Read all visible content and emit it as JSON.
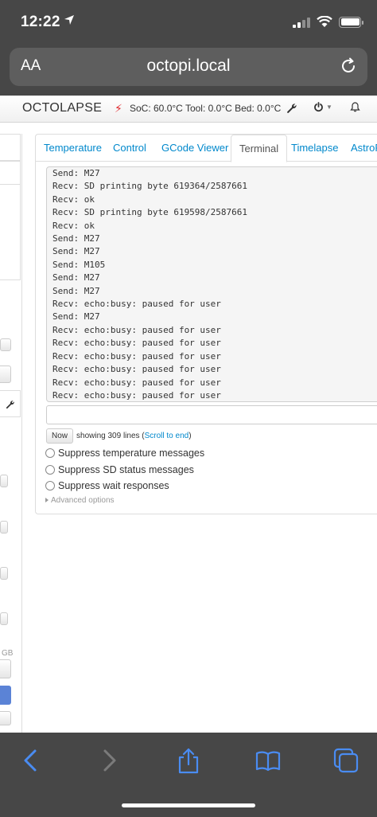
{
  "status_bar": {
    "time": "12:22"
  },
  "browser": {
    "text_size_label": "AA",
    "url": "octopi.local"
  },
  "navbar": {
    "brand": "OCTOLAPSE",
    "temperatures": "SoC: 60.0°C Tool: 0.0°C Bed: 0.0°C",
    "icons": [
      "bolt-icon",
      "wrench-icon",
      "power-icon",
      "bell-icon"
    ]
  },
  "tabs": [
    {
      "label": "Temperature"
    },
    {
      "label": "Control"
    },
    {
      "label": "GCode Viewer"
    },
    {
      "label": "Terminal",
      "active": true
    },
    {
      "label": "Timelapse"
    },
    {
      "label": "AstroF"
    }
  ],
  "terminal": {
    "lines": [
      "Send: M27",
      "Recv: SD printing byte 619364/2587661",
      "Recv: ok",
      "Recv: SD printing byte 619598/2587661",
      "Recv: ok",
      "Send: M27",
      "Send: M27",
      "Send: M105",
      "Send: M27",
      "Send: M27",
      "Recv: echo:busy: paused for user",
      "Send: M27",
      "Recv: echo:busy: paused for user",
      "Recv: echo:busy: paused for user",
      "Recv: echo:busy: paused for user",
      "Recv: echo:busy: paused for user",
      "Recv: echo:busy: paused for user",
      "Recv: echo:busy: paused for user"
    ],
    "command_value": "",
    "now_button": "Now",
    "line_info": "showing 309 lines (",
    "scroll_link": "Scroll to end",
    "line_info_close": ")",
    "options": [
      {
        "label": "Suppress temperature messages",
        "checked": false
      },
      {
        "label": "Suppress SD status messages",
        "checked": false
      },
      {
        "label": "Suppress wait responses",
        "checked": false
      }
    ],
    "advanced_label": "Advanced options"
  },
  "sidebar": {
    "fragment_text": "GB"
  },
  "colors": {
    "link": "#0088cc",
    "chrome": "#474747",
    "alert": "#e0252a",
    "primary_button": "#5b83d6"
  }
}
